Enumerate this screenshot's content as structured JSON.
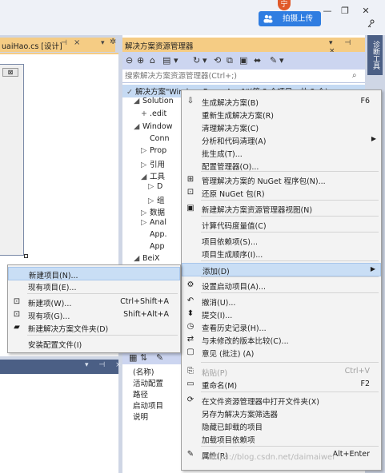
{
  "topbar": {
    "avatar_text": "宁",
    "upload_button": "拍摄上传",
    "window_controls": [
      "—",
      "❐",
      "✕"
    ],
    "feedback_icon": "feedback-icon"
  },
  "document_tab": {
    "label": "uaiHao.cs [设计]",
    "pin": "⊣",
    "close": "×",
    "dropdown": "▾",
    "gear": "✲"
  },
  "form_designer": {
    "mini_close": "⊠"
  },
  "bottom_left_panel": {
    "controls": "▾ ⊣ ×"
  },
  "solution_explorer": {
    "title": "解决方案资源管理器",
    "header_controls": "▾ ⊣ ×",
    "search_placeholder": "搜索解决方案资源管理器(Ctrl+;)",
    "tree": [
      {
        "indent": 0,
        "prefix": "✓",
        "text": "解决方案\"WindowsFormsApp1\"(第 3 个项目，共 3 个)"
      },
      {
        "indent": 1,
        "prefix": "◢",
        "text": "Solution"
      },
      {
        "indent": 2,
        "prefix": "+",
        "text": ".edit"
      },
      {
        "indent": 1,
        "prefix": "◢",
        "text": "Window"
      },
      {
        "indent": 2,
        "prefix": "",
        "text": "Conn"
      },
      {
        "indent": 2,
        "prefix": "▷",
        "text": "Prop"
      },
      {
        "indent": 2,
        "prefix": "▷",
        "text": "引用"
      },
      {
        "indent": 2,
        "prefix": "◢",
        "text": "工具"
      },
      {
        "indent": 3,
        "prefix": "▷",
        "text": "D"
      },
      {
        "indent": 3,
        "prefix": "▷",
        "text": "组"
      },
      {
        "indent": 2,
        "prefix": "▷",
        "text": "数据"
      },
      {
        "indent": 2,
        "prefix": "▷",
        "text": "Anal"
      },
      {
        "indent": 2,
        "prefix": "",
        "text": "App."
      },
      {
        "indent": 2,
        "prefix": "",
        "text": "App"
      },
      {
        "indent": 1,
        "prefix": "◢",
        "text": "BeiX"
      },
      {
        "indent": 2,
        "prefix": "▷",
        "text": "B"
      }
    ]
  },
  "context_menu": {
    "items": [
      {
        "icon": "build-icon",
        "glyph": "⇩",
        "label": "生成解决方案(B)",
        "shortcut": "F6"
      },
      {
        "icon": "",
        "glyph": "",
        "label": "重新生成解决方案(R)",
        "shortcut": ""
      },
      {
        "icon": "",
        "glyph": "",
        "label": "清理解决方案(C)",
        "shortcut": ""
      },
      {
        "icon": "",
        "glyph": "",
        "label": "分析和代码清理(A)",
        "shortcut": "",
        "submenu": true
      },
      {
        "icon": "",
        "glyph": "",
        "label": "批生成(T)...",
        "shortcut": ""
      },
      {
        "icon": "",
        "glyph": "",
        "label": "配置管理器(O)...",
        "shortcut": ""
      },
      {
        "icon": "nuget-icon",
        "glyph": "⊞",
        "label": "管理解决方案的 NuGet 程序包(N)...",
        "shortcut": ""
      },
      {
        "icon": "restore-icon",
        "glyph": "⊡",
        "label": "还原 NuGet 包(R)",
        "shortcut": ""
      },
      {
        "icon": "new-view-icon",
        "glyph": "▣",
        "label": "新建解决方案资源管理器视图(N)",
        "shortcut": ""
      },
      {
        "icon": "",
        "glyph": "",
        "label": "计算代码度量值(C)",
        "shortcut": ""
      },
      {
        "icon": "",
        "glyph": "",
        "label": "项目依赖项(S)...",
        "shortcut": ""
      },
      {
        "icon": "",
        "glyph": "",
        "label": "项目生成顺序(I)...",
        "shortcut": ""
      },
      {
        "icon": "",
        "glyph": "",
        "label": "添加(D)",
        "shortcut": "",
        "submenu": true
      },
      {
        "icon": "gear-icon",
        "glyph": "⚙",
        "label": "设置启动项目(A)...",
        "shortcut": ""
      },
      {
        "icon": "undo-icon",
        "glyph": "↶",
        "label": "撤消(U)...",
        "shortcut": ""
      },
      {
        "icon": "commit-icon",
        "glyph": "⬍",
        "label": "提交(I)...",
        "shortcut": ""
      },
      {
        "icon": "history-icon",
        "glyph": "◷",
        "label": "查看历史记录(H)...",
        "shortcut": ""
      },
      {
        "icon": "compare-icon",
        "glyph": "⇄",
        "label": "与未修改的版本比较(C)...",
        "shortcut": ""
      },
      {
        "icon": "comment-icon",
        "glyph": "▢",
        "label": "意见 (批注) (A)",
        "shortcut": ""
      },
      {
        "icon": "paste-icon",
        "glyph": "⎘",
        "label": "粘贴(P)",
        "shortcut": "Ctrl+V",
        "disabled": true
      },
      {
        "icon": "rename-icon",
        "glyph": "▭",
        "label": "重命名(M)",
        "shortcut": "F2"
      },
      {
        "icon": "open-folder-icon",
        "glyph": "⟳",
        "label": "在文件资源管理器中打开文件夹(X)",
        "shortcut": ""
      },
      {
        "icon": "",
        "glyph": "",
        "label": "另存为解决方案筛选器",
        "shortcut": ""
      },
      {
        "icon": "",
        "glyph": "",
        "label": "隐藏已卸载的项目",
        "shortcut": ""
      },
      {
        "icon": "",
        "glyph": "",
        "label": "加载项目依赖项",
        "shortcut": ""
      },
      {
        "icon": "wrench-icon",
        "glyph": "✎",
        "label": "属性(R)",
        "shortcut": "Alt+Enter"
      }
    ]
  },
  "add_submenu": {
    "items": [
      {
        "icon": "",
        "glyph": "",
        "label": "新建项目(N)...",
        "shortcut": ""
      },
      {
        "icon": "",
        "glyph": "",
        "label": "现有项目(E)...",
        "shortcut": ""
      },
      {
        "icon": "new-item-icon",
        "glyph": "⊡",
        "label": "新建项(W)...",
        "shortcut": "Ctrl+Shift+A"
      },
      {
        "icon": "existing-item-icon",
        "glyph": "⊡",
        "label": "现有项(G)...",
        "shortcut": "Shift+Alt+A"
      },
      {
        "icon": "new-folder-icon",
        "glyph": "▰",
        "label": "新建解决方案文件夹(D)",
        "shortcut": ""
      },
      {
        "icon": "",
        "glyph": "",
        "label": "安装配置文件(I)",
        "shortcut": ""
      }
    ]
  },
  "properties": {
    "rows": [
      "(名称)",
      "活动配置",
      "路径",
      "启动项目",
      "说明"
    ]
  },
  "right_strip": {
    "tab_label": "诊断工具"
  },
  "watermark": "https://blog.csdn.net/daimaiwei"
}
